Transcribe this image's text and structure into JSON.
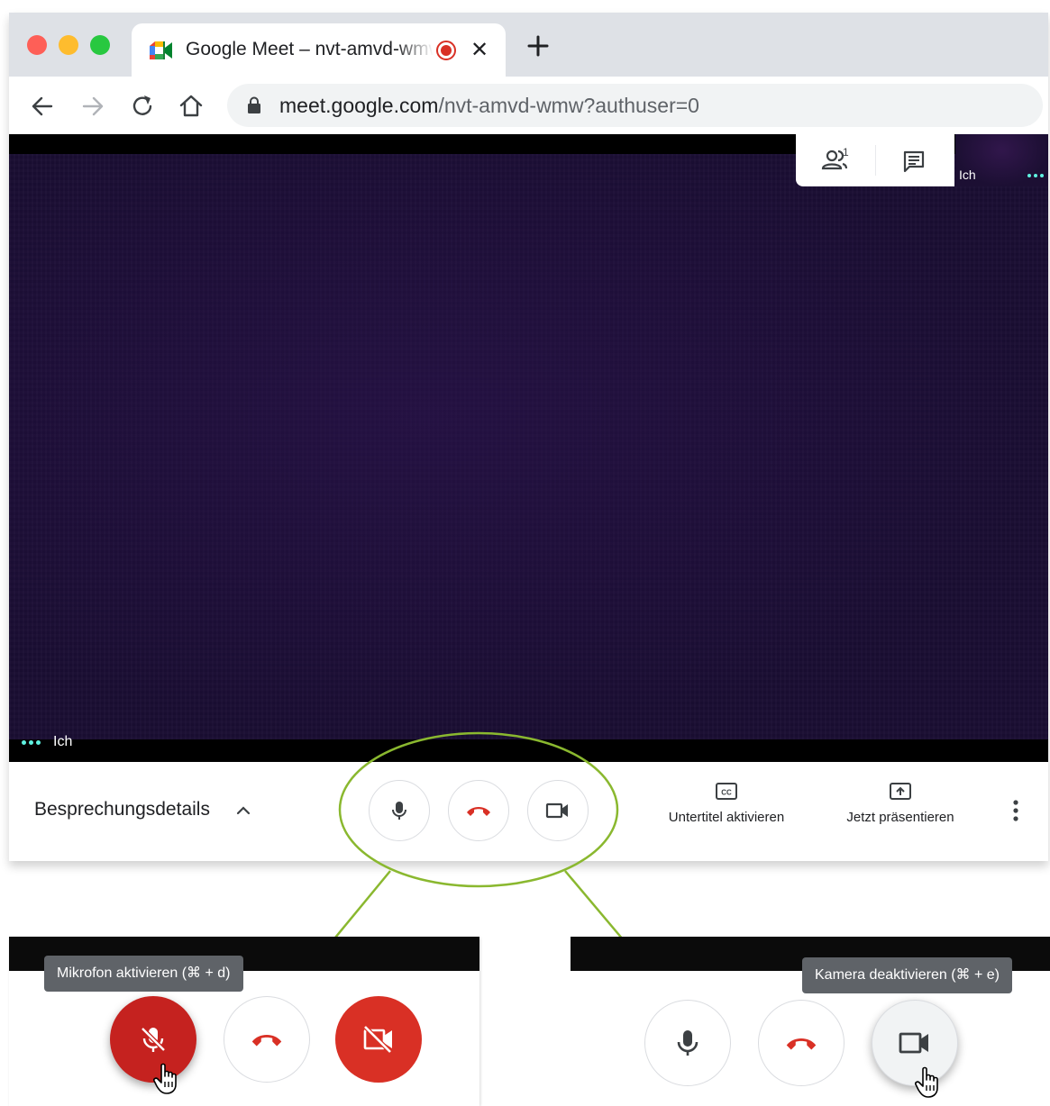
{
  "browser": {
    "tab_title": "Google Meet – nvt-amvd-wmw",
    "tab_close": "✕",
    "url_host": "meet.google.com",
    "url_path": "/nvt-amvd-wmw?authuser=0",
    "icons": [
      "back-arrow-icon",
      "forward-arrow-icon",
      "reload-icon",
      "home-icon",
      "lock-icon",
      "new-tab-icon",
      "recording-icon",
      "meet-logo-icon"
    ]
  },
  "meet": {
    "self_label": "Ich",
    "thumbnail_label": "Ich",
    "people_count": "1",
    "details_label": "Besprechungsdetails",
    "captions_label": "Untertitel aktivieren",
    "present_label": "Jetzt präsentieren",
    "colors": {
      "hangup_red": "#d93025",
      "active_dots": "#5ff2e0",
      "annotation_green": "#8ab82f"
    }
  },
  "zoom_left": {
    "tooltip": "Mikrofon aktivieren (⌘ + d)"
  },
  "zoom_right": {
    "tooltip": "Kamera deaktivieren (⌘ + e)"
  }
}
